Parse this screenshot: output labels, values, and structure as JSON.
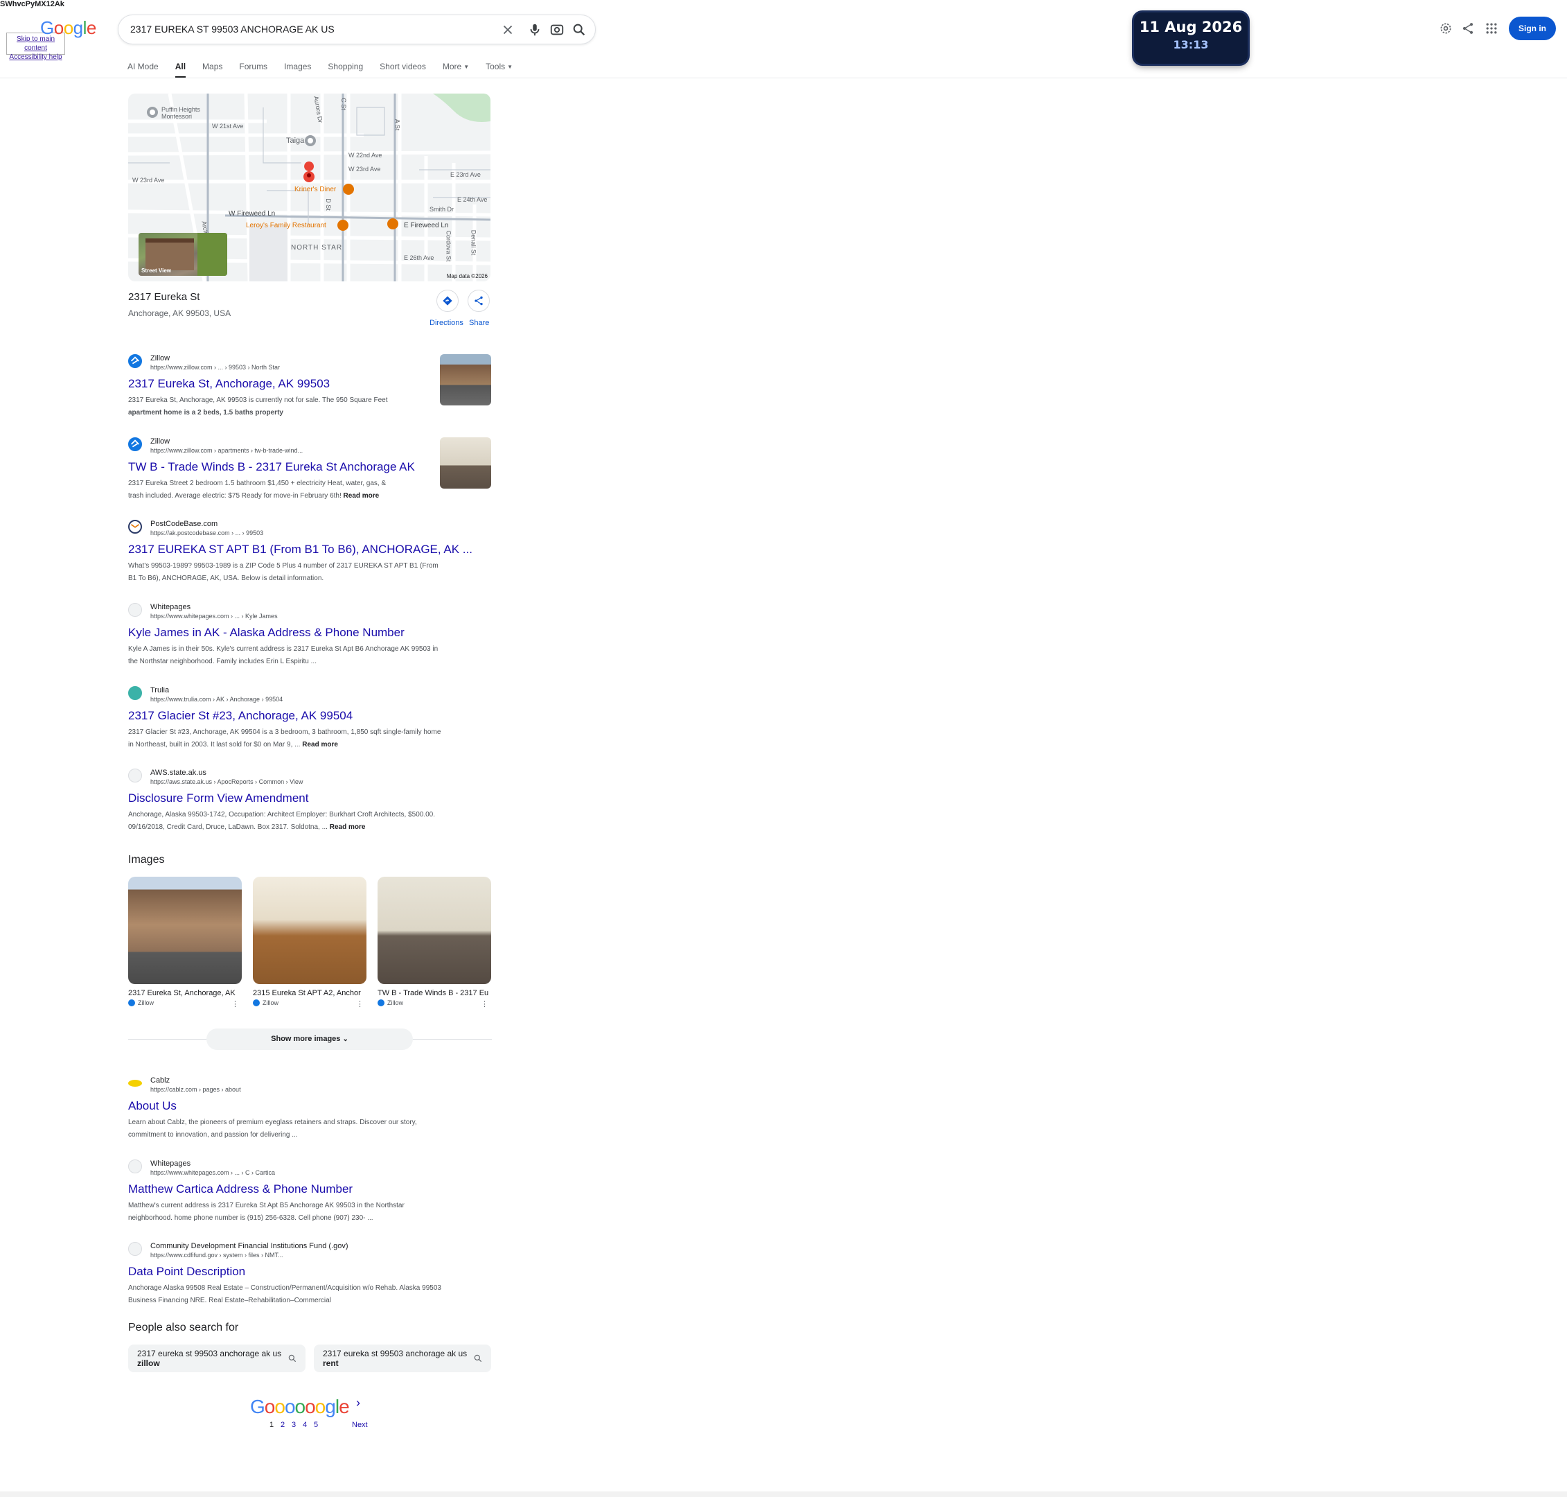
{
  "overlay_text": "SWhvcPyMX12Ak",
  "skip_links": [
    "Skip to main content",
    "Accessibility help"
  ],
  "search": {
    "query": "2317 EUREKA ST 99503 ANCHORAGE AK US"
  },
  "logo": "Google",
  "tabs": [
    {
      "label": "AI Mode"
    },
    {
      "label": "All"
    },
    {
      "label": "Maps"
    },
    {
      "label": "Forums"
    },
    {
      "label": "Images"
    },
    {
      "label": "Shopping"
    },
    {
      "label": "Short videos"
    },
    {
      "label": "More"
    },
    {
      "label": "Tools"
    }
  ],
  "active_tab": "All",
  "clock": {
    "date": "11 Aug 2026",
    "time": "13:13"
  },
  "header": {
    "signin": "Sign in"
  },
  "map": {
    "labels": {
      "puffin": "Puffin Heights\nMontessori",
      "w21": "W 21st Ave",
      "taiga": "Taiga",
      "w22": "W 22nd Ave",
      "w23a": "W 23rd Ave",
      "w23b": "W 23rd Ave",
      "e23": "E 23rd Ave",
      "kriners": "Kriner's Diner",
      "e24": "E 24th Ave",
      "smith": "Smith Dr",
      "wfire": "W Fireweed Ln",
      "leroys": "Leroy's Family Restaurant",
      "efire": "E Fireweed Ln",
      "northstar": "NORTH STAR",
      "e26": "E 26th Ave",
      "cst": "C St",
      "ast": "A St",
      "aurora": "Aurora Dr",
      "dst": "D St",
      "arctic": "Arctic",
      "cordova": "Cordova St",
      "denali": "Denali St"
    },
    "streetview": "Street View",
    "attribution": "Map data ©2026"
  },
  "place": {
    "name": "2317 Eureka St",
    "address": "Anchorage, AK 99503, USA",
    "directions": "Directions",
    "share": "Share"
  },
  "results": [
    {
      "site": "Zillow",
      "url": "https://www.zillow.com › ... › 99503 › North Star",
      "title": "2317 Eureka St, Anchorage, AK 99503",
      "snippet": "2317 Eureka St, Anchorage, AK 99503 is currently not for sale. The 950 Square Feet",
      "snippet2": "apartment home is a 2 beds, 1.5 baths property",
      "more": ""
    },
    {
      "site": "Zillow",
      "url": "https://www.zillow.com › apartments › tw-b-trade-wind...",
      "title": "TW B - Trade Winds B - 2317 Eureka St Anchorage AK",
      "snippet": "2317 Eureka Street 2 bedroom 1.5 bathroom $1,450 + electricity Heat, water, gas, &",
      "snippet2": "trash included. Average electric: $75 Ready for move-in February 6th!",
      "more": "Read more"
    },
    {
      "site": "PostCodeBase.com",
      "url": "https://ak.postcodebase.com › ... › 99503",
      "title": "2317 EUREKA ST APT B1 (From B1 To B6), ANCHORAGE, AK ...",
      "snippet": "What's 99503-1989? 99503-1989 is a ZIP Code 5 Plus 4 number of 2317 EUREKA ST APT B1 (From",
      "snippet2": "B1 To B6), ANCHORAGE, AK, USA. Below is detail information.",
      "more": ""
    },
    {
      "site": "Whitepages",
      "url": "https://www.whitepages.com › ... › Kyle James",
      "title": "Kyle James in AK - Alaska Address & Phone Number",
      "snippet": "Kyle A James is in their 50s. Kyle's current address is 2317 Eureka St Apt B6 Anchorage AK 99503 in",
      "snippet2": "the Northstar neighborhood. Family includes Erin L Espiritu ...",
      "more": ""
    },
    {
      "site": "Trulia",
      "url": "https://www.trulia.com › AK › Anchorage › 99504",
      "title": "2317 Glacier St #23, Anchorage, AK 99504",
      "snippet": "2317 Glacier St #23, Anchorage, AK 99504 is a 3 bedroom, 3 bathroom, 1,850 sqft single-family home",
      "snippet2": "in Northeast, built in 2003. It last sold for $0 on Mar 9, ...",
      "more": "Read more"
    },
    {
      "site": "AWS.state.ak.us",
      "url": "https://aws.state.ak.us › ApocReports › Common › View",
      "title": "Disclosure Form View Amendment",
      "snippet": "Anchorage, Alaska 99503-1742, Occupation: Architect Employer: Burkhart Croft Architects, $500.00.",
      "snippet2": "09/16/2018, Credit Card, Druce, LaDawn. Box 2317. Soldotna, ...",
      "more": "Read more"
    }
  ],
  "images_section": {
    "title": "Images",
    "items": [
      {
        "caption": "2317 Eureka St, Anchorage, AK",
        "source": "Zillow"
      },
      {
        "caption": "2315 Eureka St APT A2, Anchor",
        "source": "Zillow"
      },
      {
        "caption": "TW B - Trade Winds B - 2317 Eu",
        "source": "Zillow"
      }
    ],
    "show_more": "Show more images"
  },
  "results2": [
    {
      "site": "Cablz",
      "url": "https://cablz.com › pages › about",
      "title": "About Us",
      "snippet": "Learn about Cablz, the pioneers of premium eyeglass retainers and straps. Discover our story,",
      "snippet2": "commitment to innovation, and passion for delivering ..."
    },
    {
      "site": "Whitepages",
      "url": "https://www.whitepages.com › ... › C › Cartica",
      "title": "Matthew Cartica Address & Phone Number",
      "snippet": "Matthew's current address is 2317 Eureka St Apt B5 Anchorage AK 99503 in the Northstar",
      "snippet2": "neighborhood. home phone number is (915) 256-6328. Cell phone (907) 230- ..."
    },
    {
      "site": "Community Development Financial Institutions Fund (.gov)",
      "url": "https://www.cdfifund.gov › system › files › NMT...",
      "title": "Data Point Description",
      "snippet": "Anchorage Alaska 99508 Real Estate – Construction/Permanent/Acquisition w/o Rehab. Alaska 99503",
      "snippet2": "Business Financing NRE. Real Estate–Rehabilitation–Commercial"
    }
  ],
  "people_also_search": {
    "title": "People also search for",
    "chips": [
      {
        "text": "2317 eureka st 99503 anchorage ak us",
        "bold": "zillow"
      },
      {
        "text": "2317 eureka st 99503 anchorage ak us",
        "bold": "rent"
      }
    ]
  },
  "pagination": {
    "logo": "Goooooogle",
    "pages": [
      "1",
      "2",
      "3",
      "4",
      "5"
    ],
    "next": "Next"
  },
  "colors": {
    "link": "#1a0dab",
    "accent": "#0b57d0",
    "clock_bg": "#0d1b3a"
  }
}
